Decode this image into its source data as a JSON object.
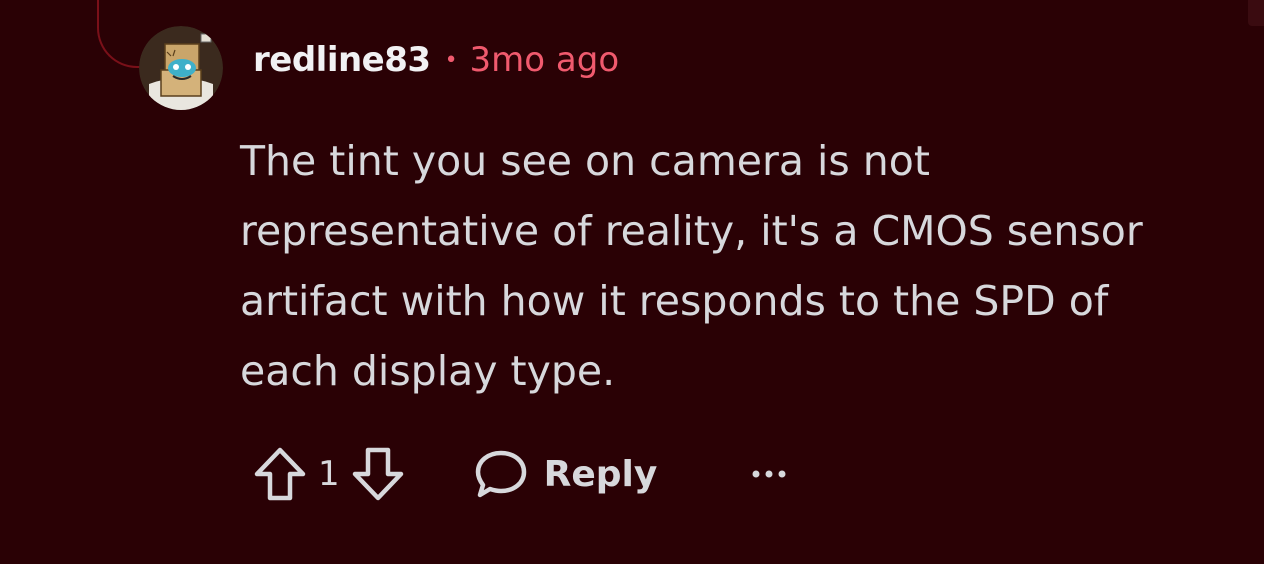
{
  "comment": {
    "username": "redline83",
    "separator": "•",
    "timestamp": "3mo ago",
    "body": "The tint you see on camera is not representative of reality, it's a CMOS sensor artifact with how it responds to the SPD of each display type.",
    "score": "1",
    "reply_label": "Reply"
  },
  "icons": {
    "upvote": "arrow-up-outline-icon",
    "downvote": "arrow-down-outline-icon",
    "reply": "speech-bubble-icon",
    "more": "ellipsis-icon"
  },
  "colors": {
    "background": "#2a0105",
    "text": "#d7d8dc",
    "username": "#f1f1f3",
    "timestamp": "#f05a6e",
    "thread_line": "#7a1019"
  }
}
